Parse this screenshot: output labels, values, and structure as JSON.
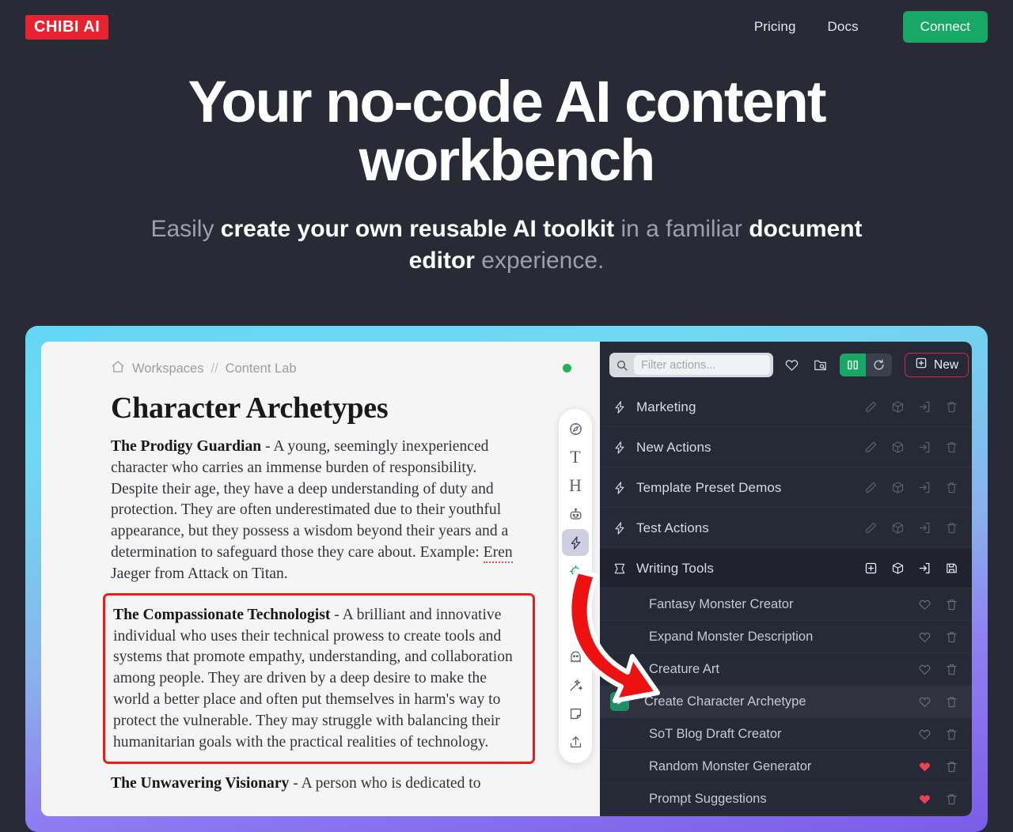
{
  "nav": {
    "logo": "CHIBI AI",
    "links": [
      {
        "label": "Pricing",
        "name": "nav-link-pricing"
      },
      {
        "label": "Docs",
        "name": "nav-link-docs"
      }
    ],
    "cta": "Connect"
  },
  "hero": {
    "title": "Your no-code AI content workbench",
    "sub_1": "Easily ",
    "sub_bold_1": "create your own reusable AI toolkit",
    "sub_2": " in a familiar ",
    "sub_bold_2": "document editor",
    "sub_3": " experience."
  },
  "app": {
    "breadcrumb": {
      "home_icon": "home-icon",
      "workspace": "Workspaces",
      "separator": "//",
      "current": "Content Lab"
    },
    "document": {
      "title": "Character Archetypes",
      "paragraphs": [
        {
          "lead": "The Prodigy Guardian",
          "text": " - A young, seemingly inexperienced character who carries an immense burden of responsibility. Despite their age, they have a deep understanding of duty and protection. They are often underestimated due to their youthful appearance, but they possess a wisdom beyond their years and a determination to safeguard those they care about. Example: ",
          "spell": "Eren",
          "tail": " Jaeger from Attack on Titan.",
          "highlighted": false
        },
        {
          "lead": "The Compassionate Technologist",
          "text": " - A brilliant and innovative individual who uses their technical prowess to create tools and systems that promote empathy, understanding, and collaboration among people. They are driven by a deep desire to make the world a better place and often put themselves in harm's way to protect the vulnerable. They may struggle with balancing their humanitarian goals with the practical realities of technology.",
          "highlighted": true
        },
        {
          "lead": "The Unwavering Visionary",
          "text": " - A person who is dedicated to",
          "highlighted": false
        }
      ]
    },
    "toolbar": [
      {
        "icon": "compass-icon",
        "glyph": "compass",
        "active": false,
        "green": false
      },
      {
        "icon": "text-tool-icon",
        "glyph": "T",
        "active": false,
        "green": false
      },
      {
        "icon": "heading-tool-icon",
        "glyph": "H",
        "active": false,
        "green": false
      },
      {
        "icon": "robot-icon",
        "glyph": "robot",
        "active": false,
        "green": false
      },
      {
        "icon": "lightning-actions-icon",
        "glyph": "bolt",
        "active": true,
        "green": false
      },
      {
        "icon": "target-crosshair-icon",
        "glyph": "target",
        "active": false,
        "green": true
      },
      {
        "icon": "paperclip-icon",
        "glyph": "clip",
        "active": false,
        "green": false
      },
      {
        "icon": "braces-variable-icon",
        "glyph": "braces",
        "active": false,
        "green": false
      },
      {
        "icon": "ghost-icon",
        "glyph": "ghost",
        "active": false,
        "green": false
      },
      {
        "icon": "magic-wand-icon",
        "glyph": "wand",
        "active": false,
        "green": false
      },
      {
        "icon": "sticky-note-icon",
        "glyph": "note",
        "active": false,
        "green": false
      },
      {
        "icon": "upload-icon",
        "glyph": "upload",
        "active": false,
        "green": false
      }
    ],
    "actions_panel": {
      "search_placeholder": "Filter actions...",
      "search_value": "",
      "header_icons": [
        {
          "name": "favorites-filter-icon",
          "glyph": "heart"
        },
        {
          "name": "browse-library-icon",
          "glyph": "folder-search"
        }
      ],
      "view_toggle": [
        {
          "name": "panel-view-toggle",
          "glyph": "columns",
          "active": true
        },
        {
          "name": "reset-view-toggle",
          "glyph": "undo",
          "active": false
        }
      ],
      "new_button": "New",
      "groups": [
        {
          "label": "Marketing",
          "icon": "lightning-icon",
          "expanded": false,
          "actions_icons": [
            "edit-icon",
            "package-icon",
            "import-icon",
            "delete-icon"
          ],
          "items": []
        },
        {
          "label": "New Actions",
          "icon": "lightning-icon",
          "expanded": false,
          "actions_icons": [
            "edit-icon",
            "package-icon",
            "import-icon",
            "delete-icon"
          ],
          "items": []
        },
        {
          "label": "Template Preset Demos",
          "icon": "lightning-icon",
          "expanded": false,
          "actions_icons": [
            "edit-icon",
            "package-icon",
            "import-icon",
            "delete-icon"
          ],
          "items": []
        },
        {
          "label": "Test Actions",
          "icon": "lightning-icon",
          "expanded": false,
          "actions_icons": [
            "edit-icon",
            "package-icon",
            "import-icon",
            "delete-icon"
          ],
          "items": []
        },
        {
          "label": "Writing Tools",
          "icon": "bookmark-icon",
          "expanded": true,
          "actions_icons": [
            "add-icon",
            "package-icon",
            "import-icon",
            "save-icon"
          ],
          "items": [
            {
              "label": "Fantasy Monster Creator",
              "favorite": false,
              "selected": false
            },
            {
              "label": "Expand Monster Description",
              "favorite": false,
              "selected": false
            },
            {
              "label": "Creature Art",
              "favorite": false,
              "selected": false
            },
            {
              "label": "Create Character Archetype",
              "favorite": false,
              "selected": true
            },
            {
              "label": "SoT Blog Draft Creator",
              "favorite": false,
              "selected": false
            },
            {
              "label": "Random Monster Generator",
              "favorite": true,
              "selected": false
            },
            {
              "label": "Prompt Suggestions",
              "favorite": true,
              "selected": false
            }
          ]
        }
      ]
    }
  },
  "colors": {
    "page_bg": "#282a36",
    "logo_red": "#e8232f",
    "accent_green": "#17a866",
    "panel_bg": "#262936",
    "highlight_red": "#f01b1b",
    "favorite_red": "#ef4056",
    "gradient_start": "#63d7f5",
    "gradient_end": "#7b5ce8"
  }
}
